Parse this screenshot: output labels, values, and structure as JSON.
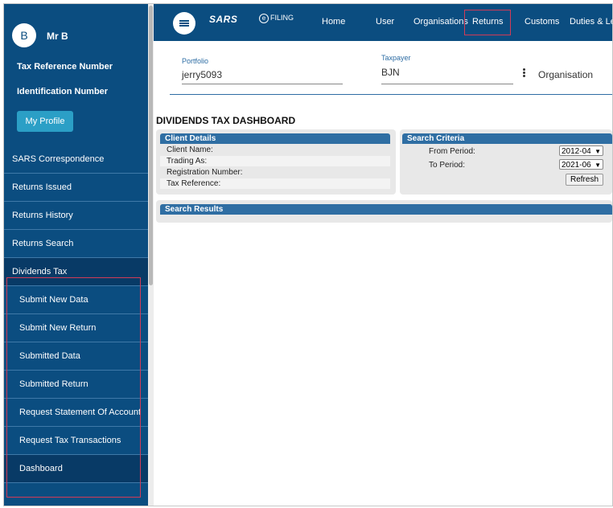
{
  "sidebar": {
    "avatar_initial": "B",
    "user_name": "Mr B",
    "tax_reference_label": "Tax Reference Number",
    "identification_label": "Identification Number",
    "profile_button": "My Profile",
    "items": [
      {
        "label": "SARS Correspondence"
      },
      {
        "label": "Returns Issued"
      },
      {
        "label": "Returns History"
      },
      {
        "label": "Returns Search"
      },
      {
        "label": "Dividends Tax"
      },
      {
        "label": "Submit New Data"
      },
      {
        "label": "Submit New Return"
      },
      {
        "label": "Submitted Data"
      },
      {
        "label": "Submitted Return"
      },
      {
        "label": "Request Statement Of Account"
      },
      {
        "label": "Request Tax Transactions"
      },
      {
        "label": "Dashboard"
      }
    ]
  },
  "topnav": {
    "logo_sars": "SARS",
    "logo_efiling_mark": "e",
    "logo_efiling": "FILING",
    "items": [
      "Home",
      "User",
      "Organisations",
      "Returns",
      "Customs",
      "Duties & Levi"
    ]
  },
  "filters": {
    "portfolio_label": "Portfolio",
    "portfolio_value": "jerry5093",
    "taxpayer_label": "Taxpayer",
    "taxpayer_value": "BJN",
    "organisation_label": "Organisation"
  },
  "dashboard": {
    "title": "DIVIDENDS TAX DASHBOARD",
    "client_details": {
      "header": "Client Details",
      "rows": [
        "Client Name:",
        "Trading As:",
        "Registration Number:",
        "Tax Reference:"
      ]
    },
    "search_criteria": {
      "header": "Search Criteria",
      "from_label": "From Period:",
      "from_value": "2012-04",
      "to_label": "To Period:",
      "to_value": "2021-06",
      "refresh": "Refresh"
    },
    "search_results_header": "Search Results"
  },
  "colors": {
    "primary": "#0b4d80",
    "panel_header": "#2f6ea3",
    "profile_button": "#2b9fc6",
    "highlight": "#d23b57"
  }
}
